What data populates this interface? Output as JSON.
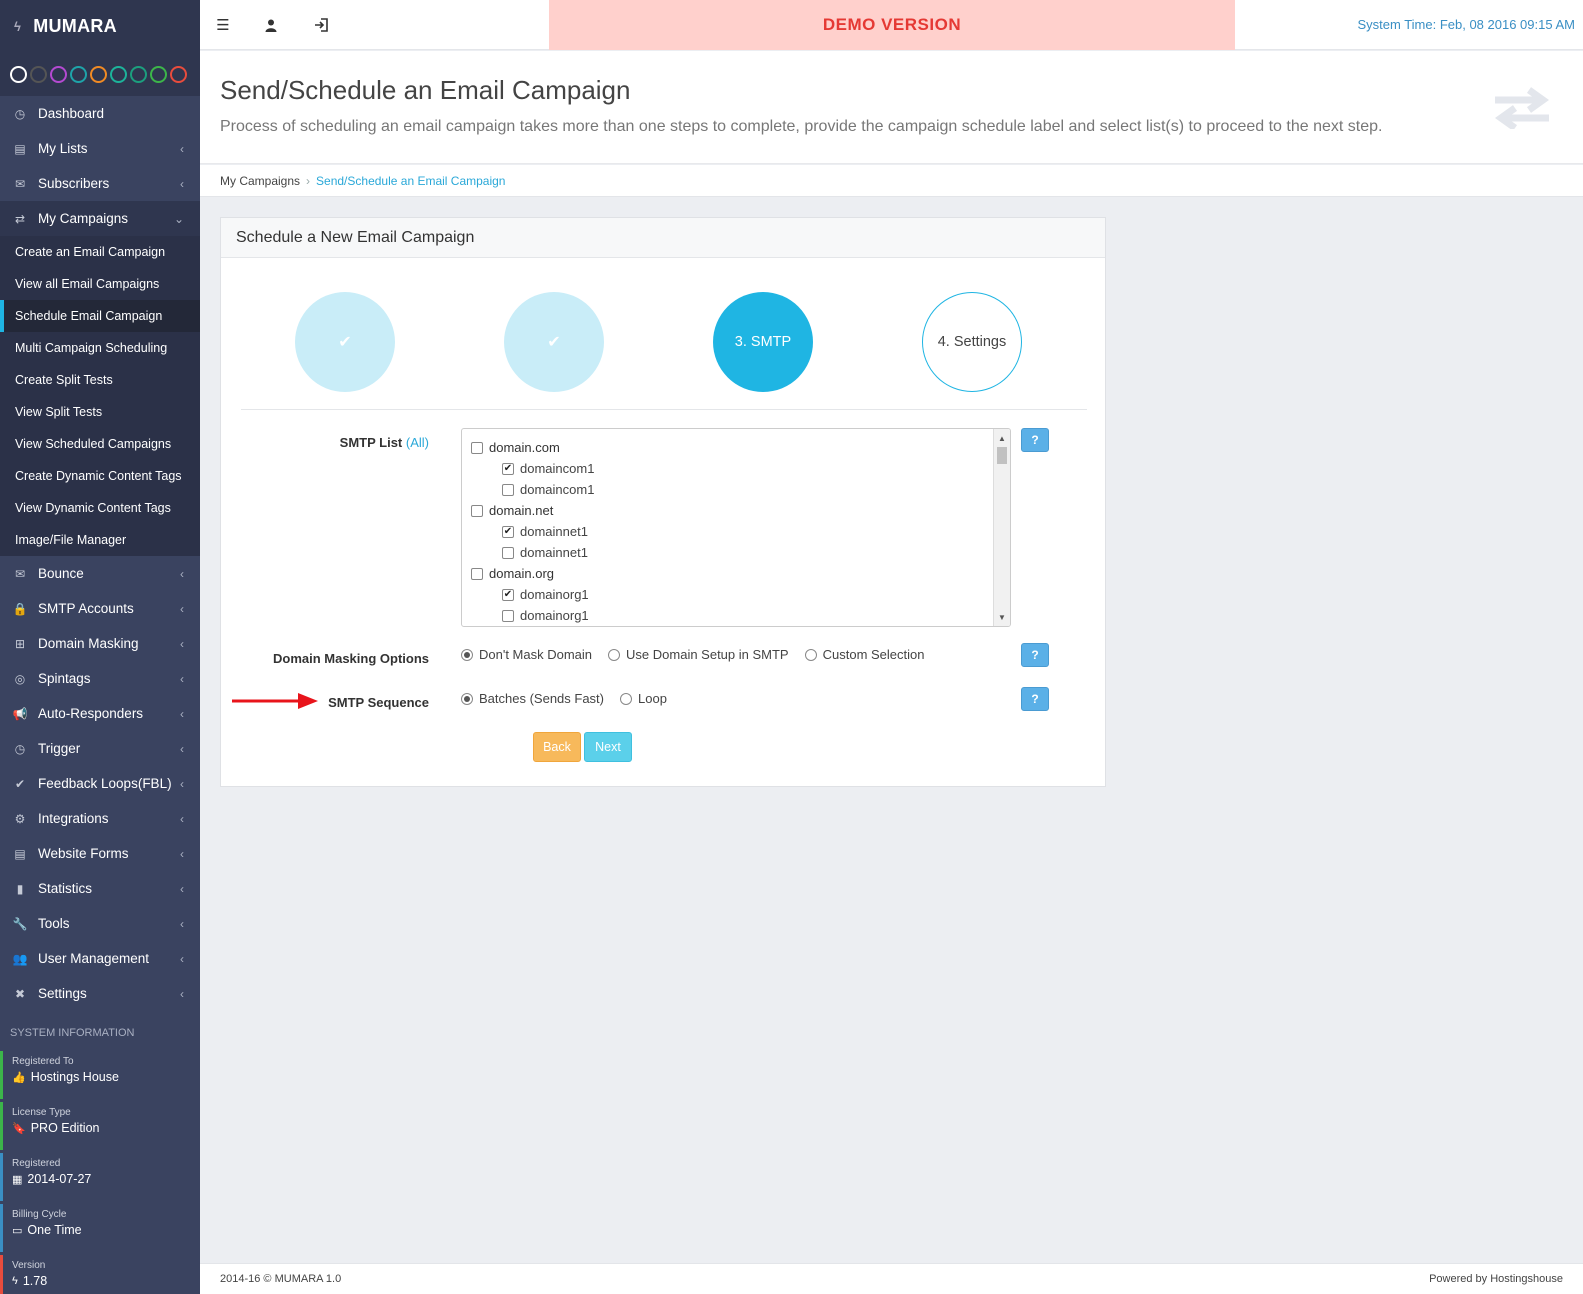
{
  "brand": {
    "name": "MUMARA"
  },
  "theme_swatches": [
    "#ffffff",
    "#555555",
    "#b44ad1",
    "#1fa4a9",
    "#f08a24",
    "#1db39a",
    "#1c9f7e",
    "#3cb54a",
    "#e84c3d"
  ],
  "sidebar": {
    "items": [
      {
        "label": "Dashboard",
        "icon": "dashboard-icon",
        "glyph": "◷",
        "has_chevron": false
      },
      {
        "label": "My Lists",
        "icon": "clipboard-icon",
        "glyph": "▤",
        "has_chevron": true
      },
      {
        "label": "Subscribers",
        "icon": "envelope-icon",
        "glyph": "✉",
        "has_chevron": true
      },
      {
        "label": "My Campaigns",
        "icon": "exchange-icon",
        "glyph": "⇄",
        "has_chevron": true,
        "open": true
      },
      {
        "label": "Bounce",
        "icon": "envelope-open-icon",
        "glyph": "✉",
        "has_chevron": true
      },
      {
        "label": "SMTP Accounts",
        "icon": "lock-icon",
        "glyph": "🔒",
        "has_chevron": true
      },
      {
        "label": "Domain Masking",
        "icon": "sitemap-icon",
        "glyph": "⊞",
        "has_chevron": true
      },
      {
        "label": "Spintags",
        "icon": "target-icon",
        "glyph": "◎",
        "has_chevron": true
      },
      {
        "label": "Auto-Responders",
        "icon": "bullhorn-icon",
        "glyph": "📢",
        "has_chevron": true
      },
      {
        "label": "Trigger",
        "icon": "clock-icon",
        "glyph": "◷",
        "has_chevron": true
      },
      {
        "label": "Feedback Loops(FBL)",
        "icon": "check-circle-icon",
        "glyph": "✔",
        "has_chevron": true
      },
      {
        "label": "Integrations",
        "icon": "cogs-icon",
        "glyph": "⚙",
        "has_chevron": true
      },
      {
        "label": "Website Forms",
        "icon": "form-icon",
        "glyph": "▤",
        "has_chevron": true
      },
      {
        "label": "Statistics",
        "icon": "bar-chart-icon",
        "glyph": "▮",
        "has_chevron": true
      },
      {
        "label": "Tools",
        "icon": "wrench-icon",
        "glyph": "🔧",
        "has_chevron": true
      },
      {
        "label": "User Management",
        "icon": "users-icon",
        "glyph": "👥",
        "has_chevron": true
      },
      {
        "label": "Settings",
        "icon": "tools-icon",
        "glyph": "✖",
        "has_chevron": true
      }
    ],
    "campaign_submenu": [
      {
        "label": "Create an Email Campaign",
        "active": false
      },
      {
        "label": "View all Email Campaigns",
        "active": false
      },
      {
        "label": "Schedule Email Campaign",
        "active": true
      },
      {
        "label": "Multi Campaign Scheduling",
        "active": false
      },
      {
        "label": "Create Split Tests",
        "active": false
      },
      {
        "label": "View Split Tests",
        "active": false
      },
      {
        "label": "View Scheduled Campaigns",
        "active": false
      },
      {
        "label": "Create Dynamic Content Tags",
        "active": false
      },
      {
        "label": "View Dynamic Content Tags",
        "active": false
      },
      {
        "label": "Image/File Manager",
        "active": false
      }
    ]
  },
  "system_info": {
    "title": "SYSTEM INFORMATION",
    "blocks": [
      {
        "label": "Registered To",
        "value": "Hostings House",
        "icon": "thumbs-up-icon",
        "glyph": "👍",
        "color": "#3cb54a"
      },
      {
        "label": "License Type",
        "value": "PRO Edition",
        "icon": "bookmark-icon",
        "glyph": "🔖",
        "color": "#3cb54a"
      },
      {
        "label": "Registered",
        "value": "2014-07-27",
        "icon": "calendar-icon",
        "glyph": "▦",
        "color": "#3a8fc4"
      },
      {
        "label": "Billing Cycle",
        "value": "One Time",
        "icon": "credit-card-icon",
        "glyph": "▭",
        "color": "#3a8fc4"
      },
      {
        "label": "Version",
        "value": "1.78",
        "icon": "bolt-icon",
        "glyph": "ϟ",
        "color": "#e84c3d"
      }
    ]
  },
  "topbar": {
    "demo_label": "DEMO VERSION",
    "system_time": "System Time: Feb, 08 2016 09:15 AM"
  },
  "page": {
    "title": "Send/Schedule an Email Campaign",
    "description": "Process of scheduling an email campaign takes more than one steps to complete, provide the campaign schedule label and select list(s) to proceed to the next step."
  },
  "breadcrumb": {
    "parent": "My Campaigns",
    "separator": "›",
    "current": "Send/Schedule an Email Campaign"
  },
  "panel": {
    "title": "Schedule a New Email Campaign",
    "steps": [
      {
        "label": "✔",
        "state": "done"
      },
      {
        "label": "✔",
        "state": "done"
      },
      {
        "label": "3. SMTP",
        "state": "current"
      },
      {
        "label": "4. Settings",
        "state": "todo"
      }
    ]
  },
  "form": {
    "smtp_list_label": "SMTP List",
    "smtp_list_all": "(All)",
    "smtp_items": [
      {
        "label": "domain.com",
        "type": "group",
        "checked": false
      },
      {
        "label": "domaincom1",
        "type": "child",
        "checked": true
      },
      {
        "label": "domaincom1",
        "type": "child",
        "checked": false
      },
      {
        "label": "domain.net",
        "type": "group",
        "checked": false
      },
      {
        "label": "domainnet1",
        "type": "child",
        "checked": true
      },
      {
        "label": "domainnet1",
        "type": "child",
        "checked": false
      },
      {
        "label": "domain.org",
        "type": "group",
        "checked": false
      },
      {
        "label": "domainorg1",
        "type": "child",
        "checked": true
      },
      {
        "label": "domainorg1",
        "type": "child",
        "checked": false
      }
    ],
    "help_label": "?",
    "masking_label": "Domain Masking Options",
    "masking_options": [
      {
        "label": "Don't Mask Domain",
        "selected": true
      },
      {
        "label": "Use Domain Setup in SMTP",
        "selected": false
      },
      {
        "label": "Custom Selection",
        "selected": false
      }
    ],
    "sequence_label": "SMTP Sequence",
    "sequence_options": [
      {
        "label": "Batches (Sends Fast)",
        "selected": true
      },
      {
        "label": "Loop",
        "selected": false
      }
    ],
    "back_label": "Back",
    "next_label": "Next"
  },
  "footer": {
    "left": "2014-16 © MUMARA 1.0",
    "right": "Powered by Hostingshouse"
  },
  "colors": {
    "sidebar_bg": "#3a4360",
    "accent": "#1fb5e3",
    "demo_bg": "#ffd0cc",
    "demo_text": "#e53934",
    "back_btn": "#f7b95b",
    "next_btn": "#5bd0ea",
    "annotation_arrow": "#e8141b"
  }
}
